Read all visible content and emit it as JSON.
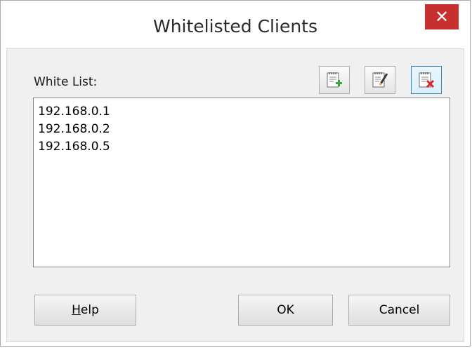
{
  "window": {
    "title": "Whitelisted Clients",
    "close_glyph": "✕"
  },
  "whitelist": {
    "label": "White List:",
    "items": [
      "192.168.0.1",
      "192.168.0.2",
      "192.168.0.5"
    ]
  },
  "toolbar": {
    "add_icon": "add-entry-icon",
    "edit_icon": "edit-entry-icon",
    "delete_icon": "delete-entry-icon"
  },
  "buttons": {
    "help_mnemonic": "H",
    "help_rest": "elp",
    "ok": "OK",
    "cancel": "Cancel"
  },
  "colors": {
    "close_red": "#c7302f",
    "add_green": "#3aa53a",
    "delete_red": "#d42a2a"
  }
}
